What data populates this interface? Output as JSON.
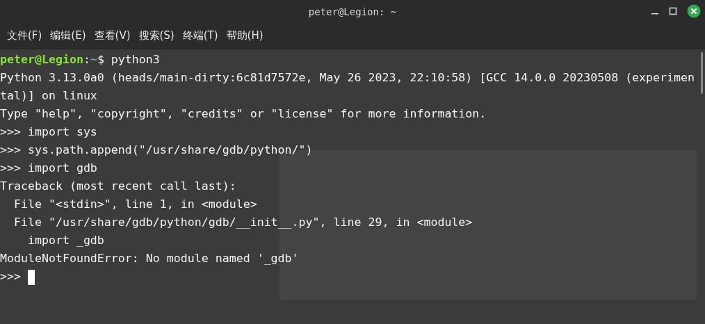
{
  "window": {
    "title": "peter@Legion: ~"
  },
  "menu": [
    {
      "label": "文件(F)"
    },
    {
      "label": "编辑(E)"
    },
    {
      "label": "查看(V)"
    },
    {
      "label": "搜索(S)"
    },
    {
      "label": "终端(T)"
    },
    {
      "label": "帮助(H)"
    }
  ],
  "lines": [
    {
      "kind": "prompt",
      "user": "peter@Legion",
      "sep": ":",
      "path": "~",
      "command": "$ python3"
    },
    {
      "kind": "output",
      "text": "Python 3.13.0a0 (heads/main-dirty:6c81d7572e, May 26 2023, 22:10:58) [GCC 14.0.0 20230508 (experimen"
    },
    {
      "kind": "output",
      "text": "tal)] on linux"
    },
    {
      "kind": "output",
      "text": "Type \"help\", \"copyright\", \"credits\" or \"license\" for more information."
    },
    {
      "kind": "output",
      "text": ">>> import sys"
    },
    {
      "kind": "output",
      "text": ">>> sys.path.append(\"/usr/share/gdb/python/\")"
    },
    {
      "kind": "output",
      "text": ">>> import gdb"
    },
    {
      "kind": "output",
      "text": "Traceback (most recent call last):"
    },
    {
      "kind": "output",
      "text": "  File \"<stdin>\", line 1, in <module>"
    },
    {
      "kind": "output",
      "text": "  File \"/usr/share/gdb/python/gdb/__init__.py\", line 29, in <module>"
    },
    {
      "kind": "output",
      "text": "    import _gdb"
    },
    {
      "kind": "output",
      "text": "ModuleNotFoundError: No module named '_gdb'"
    },
    {
      "kind": "cursor",
      "text": ">>> "
    }
  ]
}
